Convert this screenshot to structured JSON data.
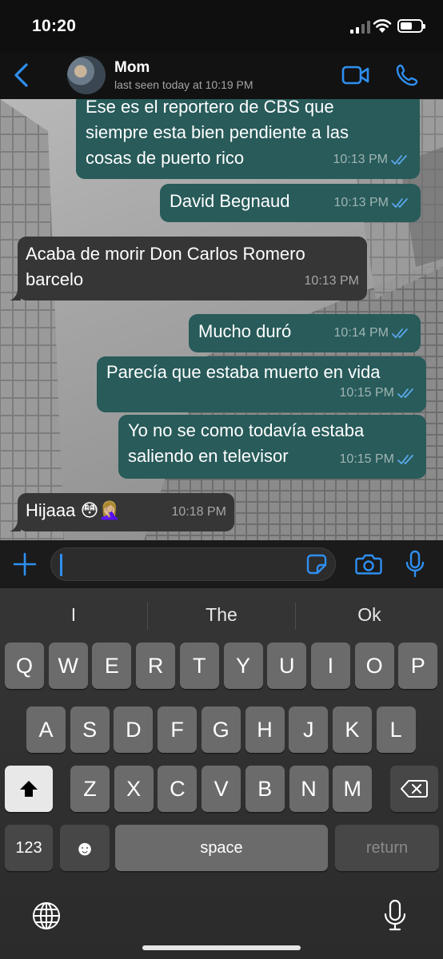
{
  "status_bar": {
    "time": "10:20",
    "battery_level": 0.6
  },
  "header": {
    "contact_name": "Mom",
    "contact_status": "last seen today at 10:19 PM",
    "icons": [
      "chevron-left-icon",
      "avatar",
      "video-call-icon",
      "phone-call-icon"
    ]
  },
  "colors": {
    "accent": "#2f8ff0",
    "outgoing_bubble": "#285b5a",
    "incoming_bubble": "#363636",
    "read_ticks": "#5aa7ea"
  },
  "messages": [
    {
      "direction": "out",
      "text": "Ese es el reportero de CBS que\nsiempre esta bien pendiente a las\ncosas de puerto rico",
      "time": "10:13 PM",
      "read": true
    },
    {
      "direction": "out",
      "text": "David Begnaud",
      "time": "10:13 PM",
      "read": true
    },
    {
      "direction": "in",
      "text": "Acaba de morir Don Carlos Romero\nbarcelo",
      "time": "10:13 PM"
    },
    {
      "direction": "out",
      "text": "Mucho duró",
      "time": "10:14 PM",
      "read": true
    },
    {
      "direction": "out",
      "text": "Parecía que estaba muerto en vida",
      "time": "10:15 PM",
      "read": true
    },
    {
      "direction": "out",
      "text": "Yo no se como todavía estaba\nsaliendo en televisor",
      "time": "10:15 PM",
      "read": true
    },
    {
      "direction": "in",
      "text": "Hijaaa 😳🤦🏼‍♀️",
      "time": "10:18 PM"
    }
  ],
  "input": {
    "value": "",
    "placeholder": ""
  },
  "keyboard": {
    "suggestions": [
      "I",
      "The",
      "Ok"
    ],
    "row1": [
      "Q",
      "W",
      "E",
      "R",
      "T",
      "Y",
      "U",
      "I",
      "O",
      "P"
    ],
    "row2": [
      "A",
      "S",
      "D",
      "F",
      "G",
      "H",
      "J",
      "K",
      "L"
    ],
    "row3": [
      "Z",
      "X",
      "C",
      "V",
      "B",
      "N",
      "M"
    ],
    "numbers_label": "123",
    "emoji_label": "☻",
    "space_label": "space",
    "return_label": "return"
  }
}
